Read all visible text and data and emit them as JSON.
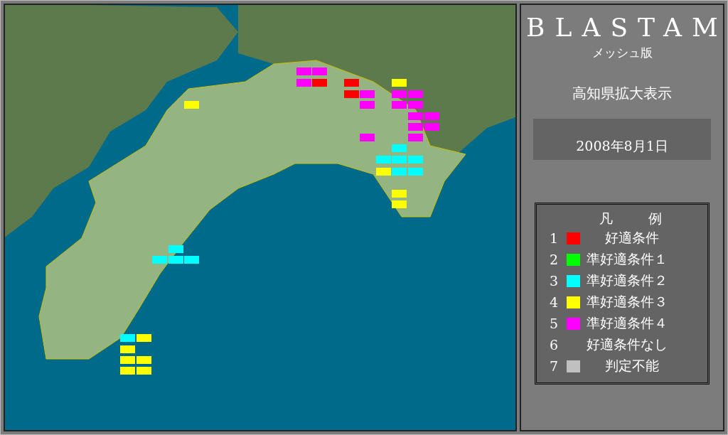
{
  "header": {
    "title": "BLASTAM",
    "subtitle": "メッシュ版",
    "region": "高知県拡大表示",
    "date": "2008年8月1日"
  },
  "legend": {
    "title_left": "凡",
    "title_right": "例",
    "items": [
      {
        "number": "1",
        "label": "好適条件",
        "color": "#ff0000"
      },
      {
        "number": "2",
        "label": "準好適条件１",
        "color": "#00ff00"
      },
      {
        "number": "3",
        "label": "準好適条件２",
        "color": "#00ffff"
      },
      {
        "number": "4",
        "label": "準好適条件３",
        "color": "#ffff00"
      },
      {
        "number": "5",
        "label": "準好適条件４",
        "color": "#ff00ff"
      },
      {
        "number": "6",
        "label": "好適条件なし"
      },
      {
        "number": "7",
        "label": "判定不能",
        "color": "#c0c0c0"
      }
    ]
  }
}
